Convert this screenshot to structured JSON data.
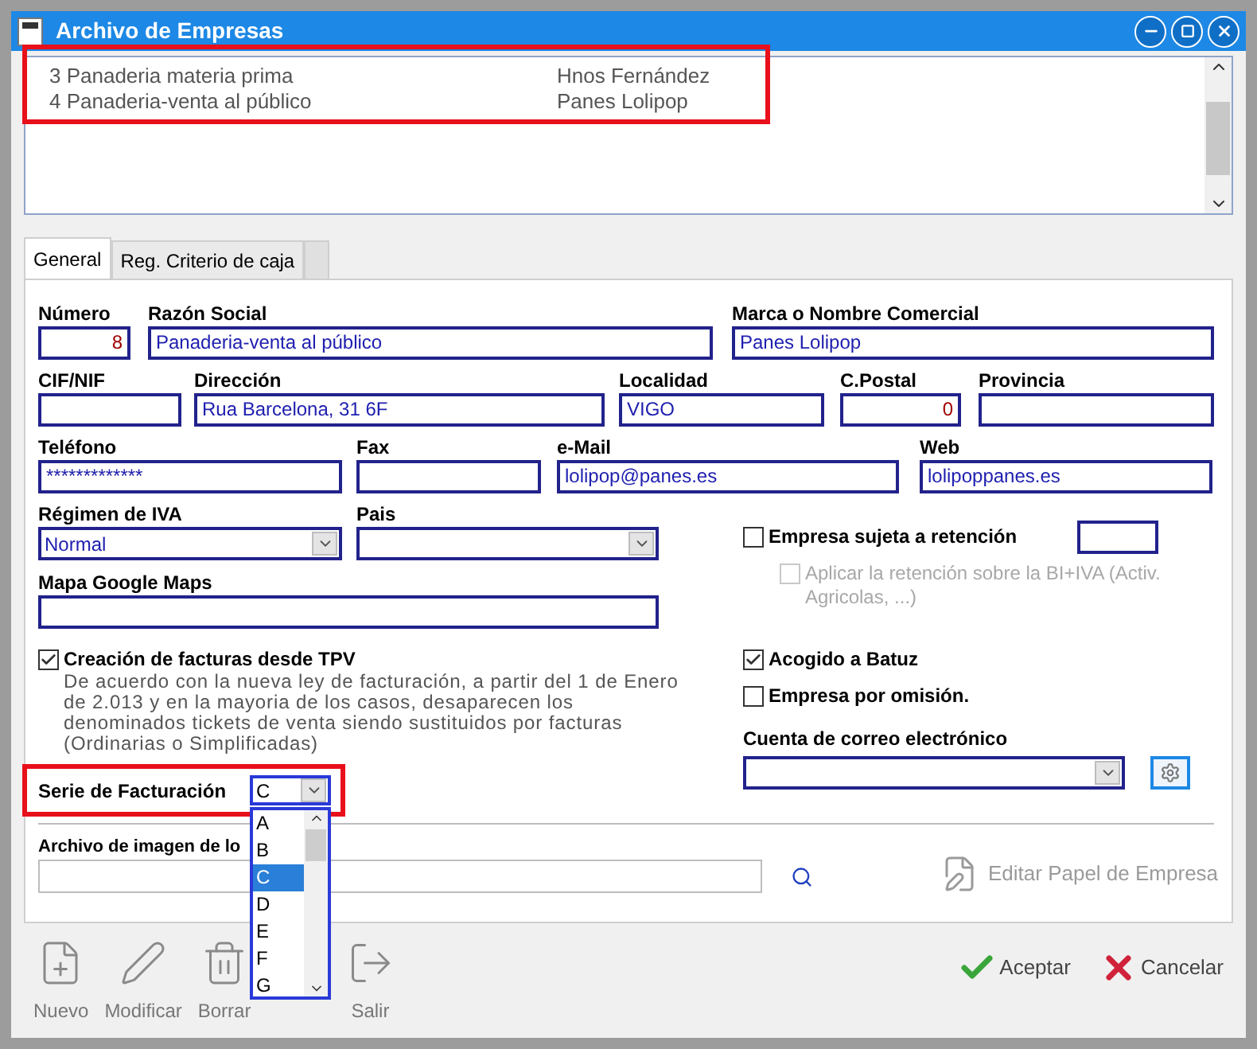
{
  "window": {
    "title": "Archivo de Empresas"
  },
  "company_list": {
    "rows": [
      {
        "name": "3 Panaderia materia prima",
        "brand": "Hnos Fernández"
      },
      {
        "name": "4 Panaderia-venta al público",
        "brand": "Panes Lolipop"
      }
    ]
  },
  "tabs": [
    {
      "label": "General",
      "selected": true
    },
    {
      "label": "Reg. Criterio de caja",
      "selected": false
    }
  ],
  "field_rows": [
    [
      {
        "label": "Número",
        "value": "8",
        "kind": "number"
      },
      {
        "label": "Razón Social",
        "value": "Panaderia-venta al público",
        "kind": "text"
      },
      {
        "label": "Marca o Nombre Comercial",
        "value": "Panes Lolipop",
        "kind": "text"
      }
    ],
    [
      {
        "label": "CIF/NIF",
        "kind": "text"
      },
      {
        "label": "Dirección",
        "value": "Rua Barcelona, 31 6F",
        "kind": "text"
      },
      {
        "label": "Localidad",
        "value": "VIGO",
        "kind": "text"
      },
      {
        "label": "C.Postal",
        "value": "0",
        "kind": "number"
      },
      {
        "label": "Provincia",
        "kind": "text"
      }
    ],
    [
      {
        "label": "Teléfono",
        "value": "*************",
        "kind": "text"
      },
      {
        "label": "Fax",
        "kind": "text"
      },
      {
        "label": "e-Mail",
        "value": "lolipop@panes.es",
        "kind": "text"
      },
      {
        "label": "Web",
        "value": "lolipoppanes.es",
        "kind": "text"
      }
    ]
  ],
  "regimen_iva": {
    "label": "Régimen de IVA",
    "value": "Normal"
  },
  "pais": {
    "label": "Pais"
  },
  "retencion": {
    "label": "Empresa sujeta a retención",
    "checked": false
  },
  "aplicar_retencion": {
    "label": "Aplicar la retención sobre la BI+IVA (Activ. Agricolas, ...)",
    "checked": false,
    "disabled": true
  },
  "mapa": {
    "label": "Mapa Google Maps"
  },
  "creacion_tpv": {
    "label": "Creación de facturas desde TPV",
    "checked": true,
    "note": "De acuerdo con la nueva ley de facturación, a partir del 1 de Enero de 2.013 y en la mayoria de los casos, desaparecen los denominados tickets de venta siendo sustituidos por facturas (Ordinarias o Simplificadas)"
  },
  "batuz": {
    "label": "Acogido a Batuz",
    "checked": true
  },
  "por_omision": {
    "label": "Empresa por omisión.",
    "checked": false
  },
  "cuenta_correo": {
    "label": "Cuenta de correo electrónico"
  },
  "serie": {
    "label": "Serie de Facturación",
    "value": "C",
    "options": [
      {
        "label": "A",
        "selected": false
      },
      {
        "label": "B",
        "selected": false
      },
      {
        "label": "C",
        "selected": true
      },
      {
        "label": "D",
        "selected": false
      },
      {
        "label": "E",
        "selected": false
      },
      {
        "label": "F",
        "selected": false
      },
      {
        "label": "G",
        "selected": false
      }
    ]
  },
  "imagen_logo": {
    "label": "Archivo de imagen de lo"
  },
  "editar_papel": {
    "label": "Editar Papel de Empresa",
    "disabled": true
  },
  "toolbar": [
    {
      "label": "Nuevo",
      "kind": "new"
    },
    {
      "label": "Modificar",
      "kind": "edit"
    },
    {
      "label": "Borrar",
      "kind": "delete"
    },
    {
      "label": "Salir",
      "kind": "exit"
    }
  ],
  "actions": [
    {
      "label": "Aceptar",
      "kind": "ok"
    },
    {
      "label": "Cancelar",
      "kind": "cancel"
    }
  ]
}
